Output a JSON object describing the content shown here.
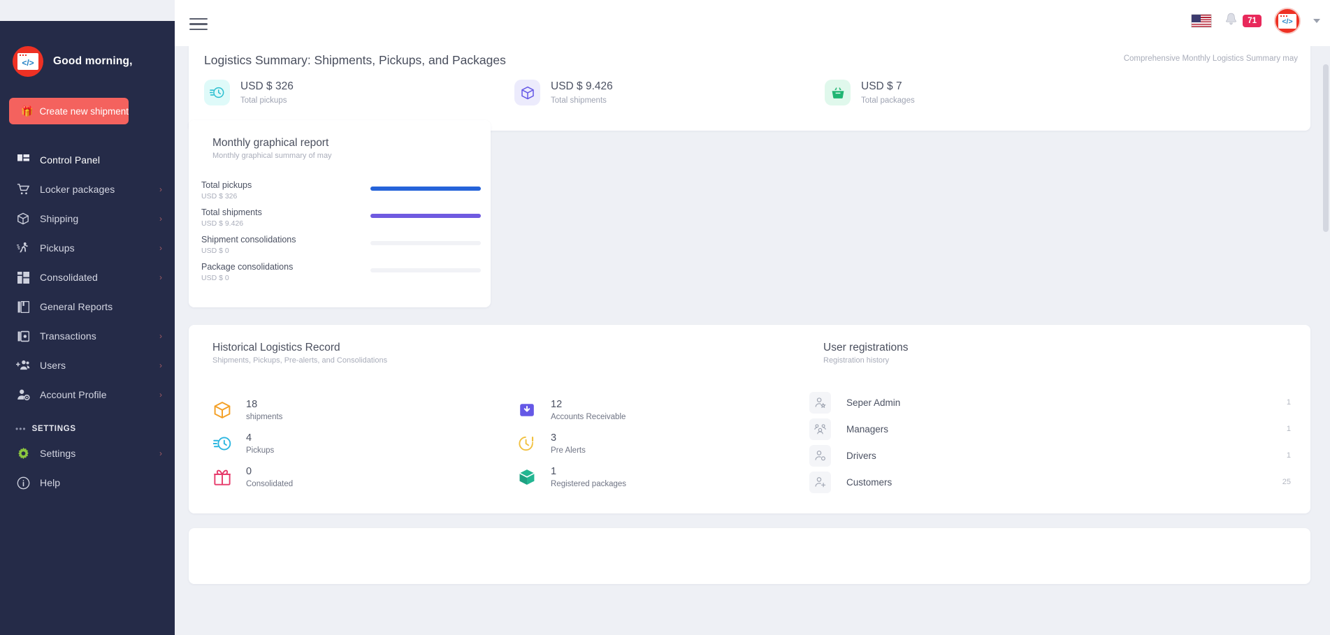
{
  "sidebar": {
    "greeting": "Good morning,",
    "logo_icon": "code-window-icon",
    "cta": {
      "label": "Create new shipment",
      "icon": "gift-icon"
    },
    "items": [
      {
        "label": "Control Panel",
        "icon": "dashboard-grid-icon",
        "chevron": "",
        "active": true
      },
      {
        "label": "Locker packages",
        "icon": "shopping-cart-icon",
        "chevron": "›",
        "active": false
      },
      {
        "label": "Shipping",
        "icon": "package-box-icon",
        "chevron": "›",
        "active": false
      },
      {
        "label": "Pickups",
        "icon": "running-person-icon",
        "chevron": "›",
        "active": false
      },
      {
        "label": "Consolidated",
        "icon": "boxes-grid-icon",
        "chevron": "›",
        "active": false
      },
      {
        "label": "General Reports",
        "icon": "book-report-icon",
        "chevron": "",
        "active": false
      },
      {
        "label": "Transactions",
        "icon": "wallet-icon",
        "chevron": "›",
        "active": false
      },
      {
        "label": "Users",
        "icon": "add-users-icon",
        "chevron": "›",
        "active": false
      },
      {
        "label": "Account Profile",
        "icon": "user-gear-icon",
        "chevron": "›",
        "active": false
      }
    ],
    "settings_section": {
      "dots": "•••",
      "title": "SETTINGS"
    },
    "settings_items": [
      {
        "label": "Settings",
        "icon": "gear-icon",
        "chevron": "›"
      },
      {
        "label": "Help",
        "icon": "info-circle-icon",
        "chevron": ""
      }
    ]
  },
  "topbar": {
    "menu_icon": "hamburger-menu-icon",
    "flag_icon": "us-flag-icon",
    "bell_icon": "notification-bell-icon",
    "notification_count": "71",
    "avatar_icon": "code-window-avatar",
    "caret_icon": "chevron-down-icon"
  },
  "summary": {
    "title": "Logistics Summary: Shipments, Pickups, and Packages",
    "subtitle": "Comprehensive Monthly Logistics Summary may",
    "stats": [
      {
        "value": "USD $ 326",
        "label": "Total pickups",
        "icon": "clock-speed-icon",
        "color": "#2bbfd0",
        "bg": "#dffaf9"
      },
      {
        "value": "USD $ 9.426",
        "label": "Total shipments",
        "icon": "package-box-icon",
        "color": "#6558e6",
        "bg": "#ecebfc"
      },
      {
        "value": "USD $ 7",
        "label": "Total packages",
        "icon": "basket-icon",
        "color": "#21b573",
        "bg": "#e0f8ec"
      }
    ]
  },
  "report": {
    "title": "Monthly graphical report",
    "subtitle": "Monthly graphical summary of may"
  },
  "chart_data": {
    "type": "bar",
    "title": "Monthly graphical report",
    "subtitle": "Monthly graphical summary of may",
    "orientation": "horizontal",
    "categories": [
      "Total pickups",
      "Total shipments",
      "Shipment consolidations",
      "Package consolidations"
    ],
    "value_labels": [
      "USD $ 326",
      "USD $ 9.426",
      "USD $ 0",
      "USD $ 0"
    ],
    "values": [
      326,
      9426,
      0,
      0
    ],
    "percent_of_track": [
      100,
      100,
      0,
      0
    ],
    "colors": [
      "#2563d9",
      "#6f5ae0",
      "#f1f2f6",
      "#f1f2f6"
    ],
    "track_color": "#f1f2f6",
    "grid": false,
    "legend": false
  },
  "historical": {
    "title": "Historical Logistics Record",
    "subtitle": "Shipments, Pickups, Pre-alerts, and Consolidations",
    "column_one": [
      {
        "number": "18",
        "label": "shipments",
        "icon": "package-box-icon",
        "color": "#f4a026"
      },
      {
        "number": "4",
        "label": "Pickups",
        "icon": "clock-speed-icon",
        "color": "#2bb6e0"
      },
      {
        "number": "0",
        "label": "Consolidated",
        "icon": "gift-icon",
        "color": "#e63a6b"
      }
    ],
    "column_two": [
      {
        "number": "12",
        "label": "Accounts Receivable",
        "icon": "inbox-down-icon",
        "color": "#6558e6"
      },
      {
        "number": "3",
        "label": "Pre Alerts",
        "icon": "clock-alert-icon",
        "color": "#f1c03e"
      },
      {
        "number": "1",
        "label": "Registered packages",
        "icon": "package-3d-icon",
        "color": "#23b692"
      }
    ]
  },
  "user_registrations": {
    "title": "User registrations",
    "subtitle": "Registration history",
    "rows": [
      {
        "name": "Seper Admin",
        "count": "1",
        "icon": "user-star-icon"
      },
      {
        "name": "Managers",
        "count": "1",
        "icon": "users-group-icon"
      },
      {
        "name": "Drivers",
        "count": "1",
        "icon": "user-circle-icon"
      },
      {
        "name": "Customers",
        "count": "25",
        "icon": "user-add-icon"
      }
    ]
  }
}
